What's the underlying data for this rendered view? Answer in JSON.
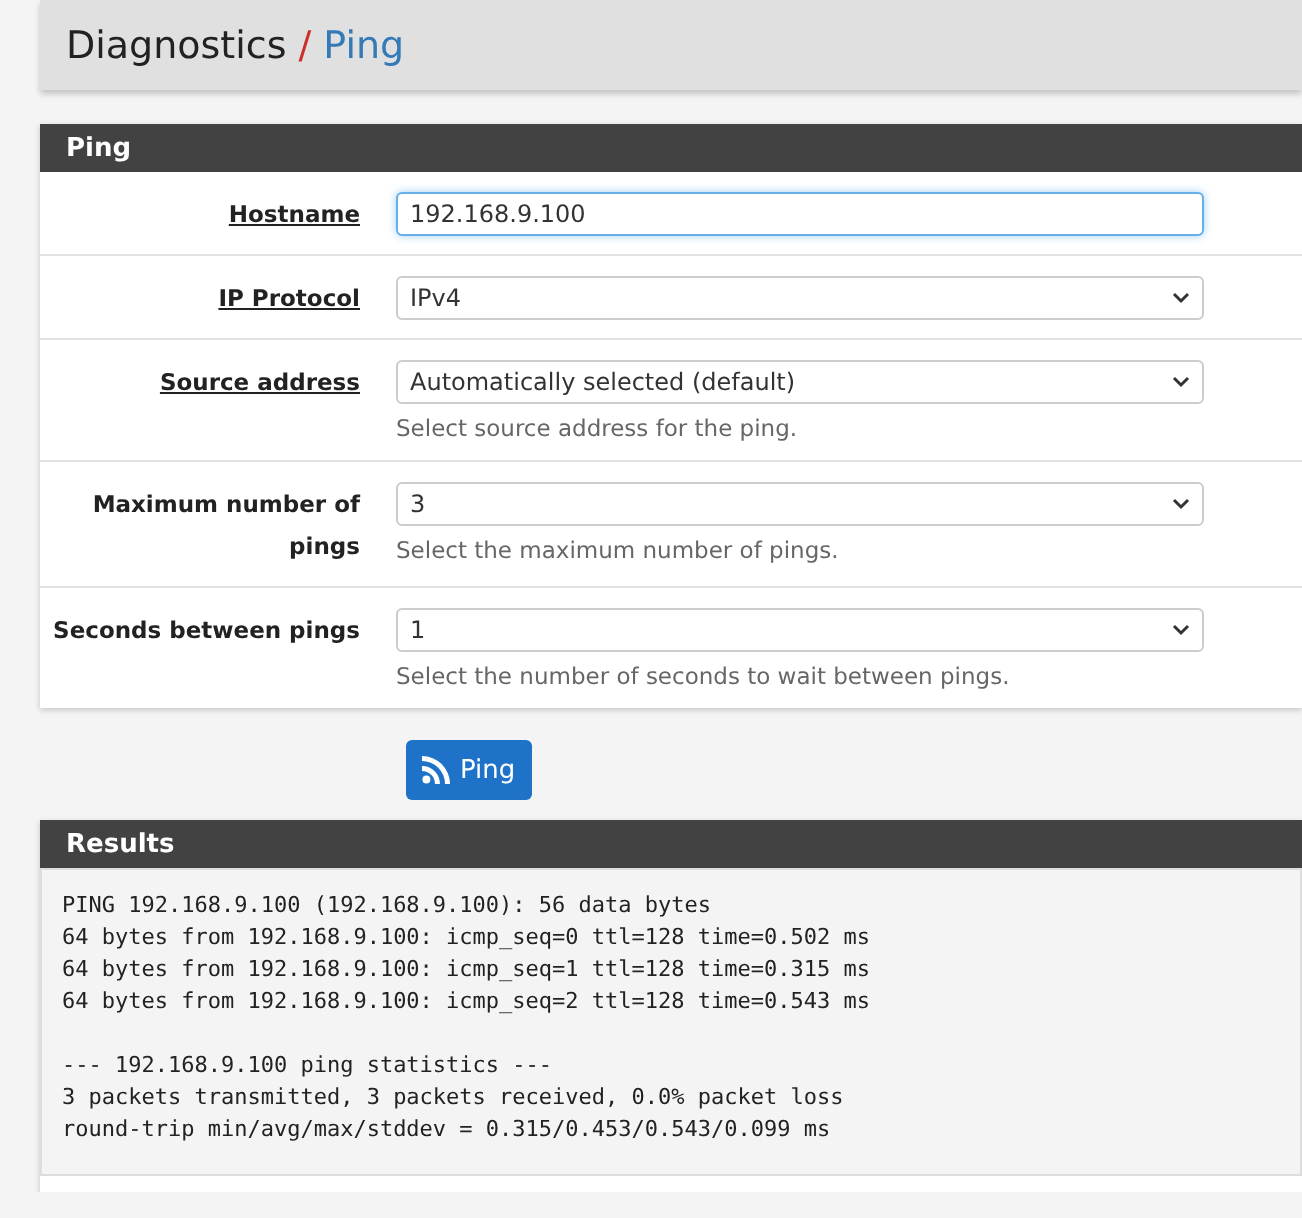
{
  "breadcrumb": {
    "section": "Diagnostics",
    "separator": "/",
    "page": "Ping"
  },
  "ping_panel": {
    "title": "Ping",
    "rows": [
      {
        "label": "Hostname",
        "label_underlined": true,
        "kind": "text",
        "value": "192.168.9.100",
        "focused": true
      },
      {
        "label": "IP Protocol",
        "label_underlined": true,
        "kind": "select",
        "value": "IPv4",
        "focused": false
      },
      {
        "label": "Source address",
        "label_underlined": true,
        "kind": "select",
        "value": "Automatically selected (default)",
        "help": "Select source address for the ping.",
        "focused": false
      },
      {
        "label": "Maximum number of pings",
        "label_underlined": false,
        "kind": "select",
        "value": "3",
        "help": "Select the maximum number of pings.",
        "focused": false
      },
      {
        "label": "Seconds between pings",
        "label_underlined": false,
        "kind": "select",
        "value": "1",
        "help": "Select the number of seconds to wait between pings.",
        "focused": false
      }
    ]
  },
  "ping_button": {
    "label": "Ping"
  },
  "results_panel": {
    "title": "Results",
    "reply_lines": [
      "PING 192.168.9.100 (192.168.9.100): 56 data bytes",
      "64 bytes from 192.168.9.100: icmp_seq=0 ttl=128 time=0.502 ms",
      "64 bytes from 192.168.9.100: icmp_seq=1 ttl=128 time=0.315 ms",
      "64 bytes from 192.168.9.100: icmp_seq=2 ttl=128 time=0.543 ms"
    ],
    "statistics_lines": [
      "--- 192.168.9.100 ping statistics ---",
      "3 packets transmitted, 3 packets received, 0.0% packet loss",
      "round-trip min/avg/max/stddev = 0.315/0.453/0.543/0.099 ms"
    ]
  }
}
